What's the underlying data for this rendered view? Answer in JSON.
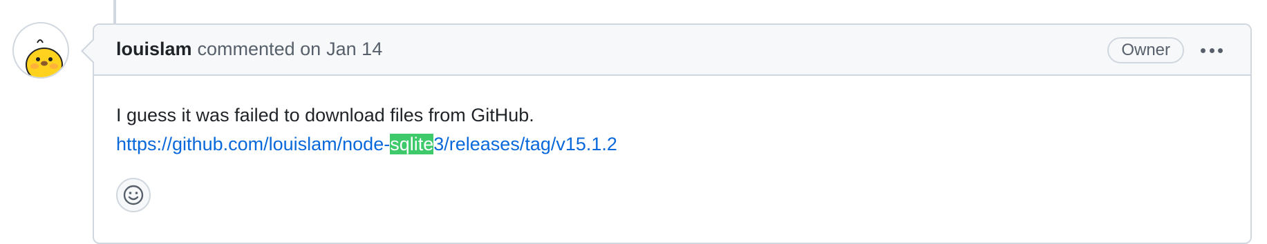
{
  "comment": {
    "author": "louislam",
    "action": "commented on",
    "date": "Jan 14",
    "badge": "Owner",
    "body_text": "I guess it was failed to download files from GitHub.",
    "link": {
      "before": "https://github.com/louislam/node-",
      "highlight": "sqlite",
      "after": "3/releases/tag/v15.1.2"
    }
  },
  "icons": {
    "avatar": "yellow-chick-avatar",
    "more": "kebab-horizontal-icon",
    "reaction": "smiley-icon"
  },
  "colors": {
    "link": "#0969da",
    "highlight": "#3ec96a",
    "border": "#d0d7de",
    "header_bg": "#f6f8fa",
    "avatar_yellow": "#ffd21f"
  }
}
